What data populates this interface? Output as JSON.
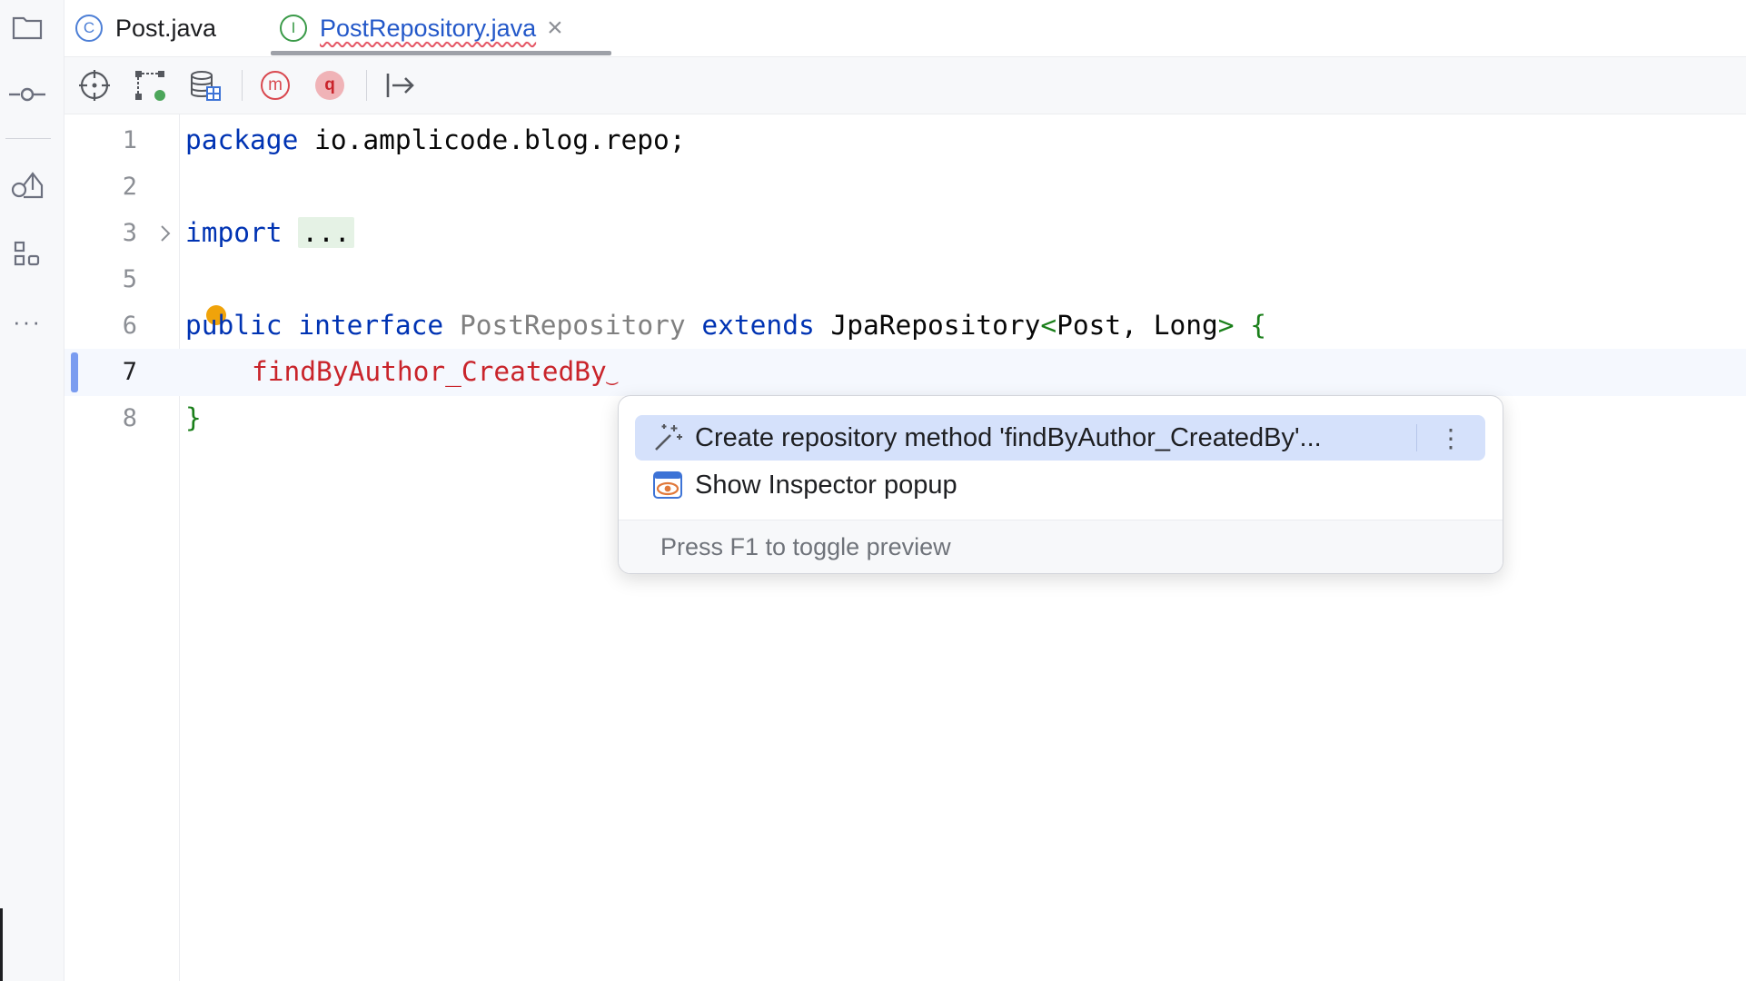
{
  "tabs": [
    {
      "label": "Post.java",
      "icon_letter": "C",
      "icon": "class-icon",
      "color": "#4d7fd6"
    },
    {
      "label": "PostRepository.java",
      "icon_letter": "I",
      "icon": "interface-icon",
      "color": "#3a9a48",
      "active": true
    }
  ],
  "toolbar": [
    "crosshair-icon",
    "diagram-icon",
    "database-icon",
    "m-icon",
    "q-icon",
    "jump-to-icon"
  ],
  "sidebar": [
    "folder-icon",
    "commit-icon",
    "pull-requests-icon",
    "structure-icon",
    "more-icon"
  ],
  "sidebar_more_label": "···",
  "toolbar_m_label": "m",
  "toolbar_q_label": "q",
  "editor": {
    "lines": [
      {
        "num": "1",
        "package_kw": "package",
        "package_name": " io.amplicode.blog.repo;"
      },
      {
        "num": "2"
      },
      {
        "num": "3",
        "import_kw": "import",
        "import_folded": "..."
      },
      {
        "num": "5"
      },
      {
        "num": "6",
        "kw1": "public",
        "kw2": "interface",
        "name": "PostRepository",
        "kw3": "extends",
        "type": "JpaRepository",
        "lt": "<",
        "args": "Post, Long",
        "gt": ">",
        "brace": "{"
      },
      {
        "num": "7",
        "code": "findByAuthor_CreatedBy",
        "current": true
      },
      {
        "num": "8",
        "brace": "}"
      }
    ]
  },
  "popup": {
    "items": [
      {
        "label": "Create repository method 'findByAuthor_CreatedBy'...",
        "icon": "magic-wand-icon",
        "selected": true
      },
      {
        "label": "Show Inspector popup",
        "icon": "inspector-icon"
      }
    ],
    "more_label": "⋮",
    "footer": "Press F1 to toggle preview"
  },
  "colors": {
    "keyword": "#0033b3",
    "error": "#c9242b",
    "selection": "#d5e1fb",
    "accent": "#7a9cf0"
  }
}
